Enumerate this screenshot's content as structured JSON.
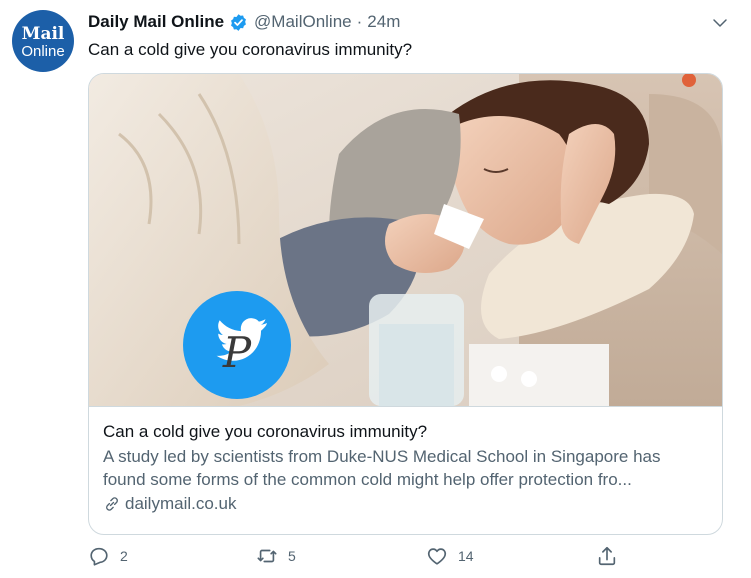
{
  "author": {
    "avatar_line1": "Mail",
    "avatar_line2": "Online",
    "name": "Daily Mail Online",
    "handle": "@MailOnline",
    "separator": "·",
    "time": "24m"
  },
  "tweet": {
    "text": "Can a cold give you coronavirus immunity?"
  },
  "card": {
    "title": "Can a cold give you coronavirus immunity?",
    "description_line1": "A study led by scientists from Duke-NUS Medical School in Singapore has",
    "description_line2": "found some forms of the common cold might help offer protection fro...",
    "domain": "dailymail.co.uk",
    "badge_letter": "P"
  },
  "actions": {
    "reply_count": "2",
    "retweet_count": "5",
    "like_count": "14"
  },
  "colors": {
    "avatar_bg": "#1c5fa8",
    "verified": "#1d9bf0",
    "twitter_badge": "#1d9bf0",
    "muted_text": "#536471"
  },
  "icons": [
    "verified-icon",
    "chevron-down-icon",
    "link-icon",
    "reply-icon",
    "retweet-icon",
    "like-icon",
    "share-icon",
    "twitter-bird-icon"
  ]
}
